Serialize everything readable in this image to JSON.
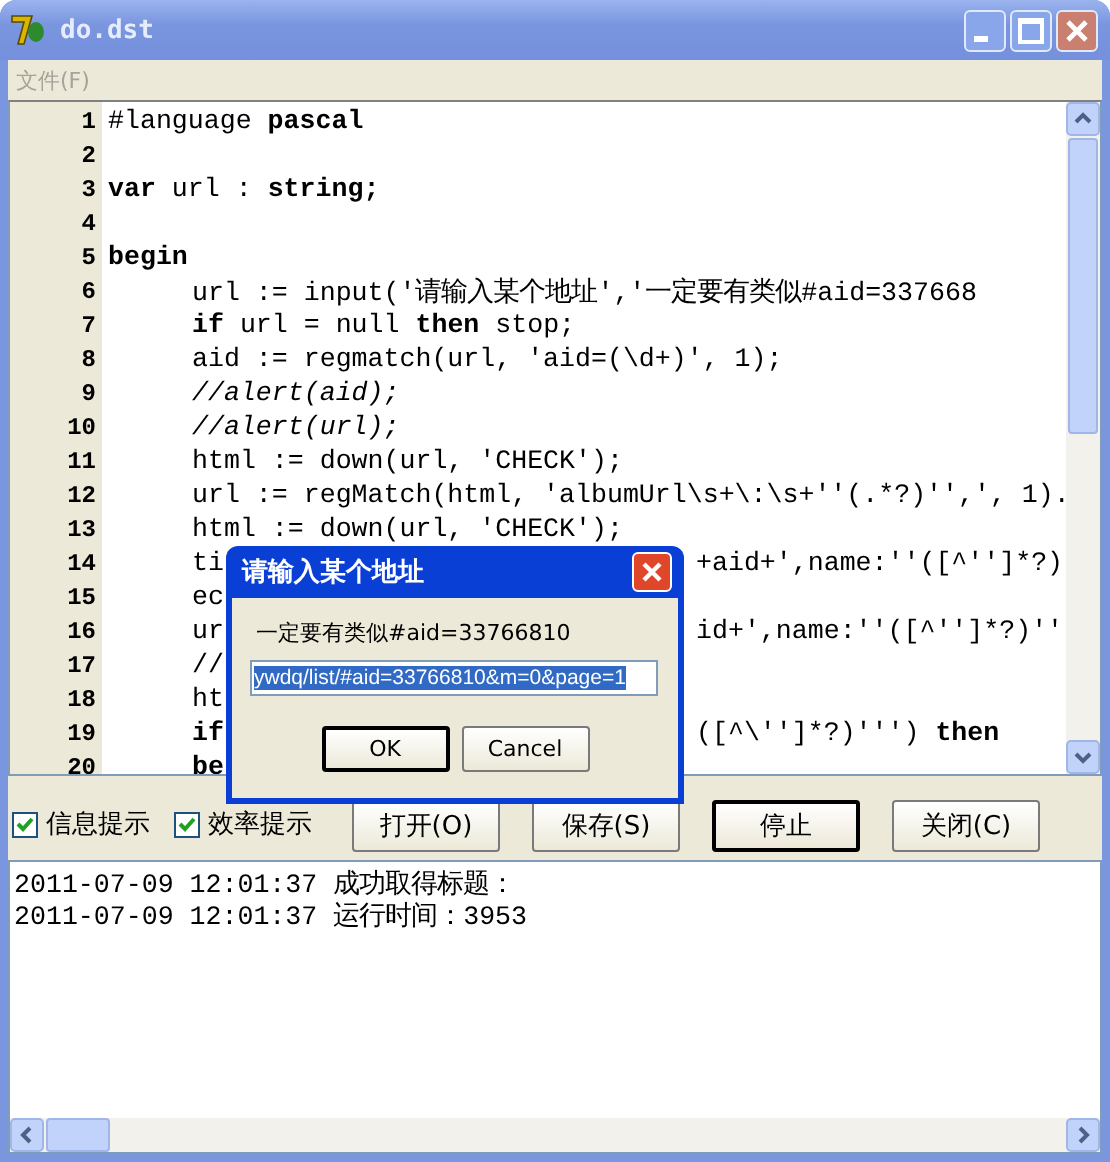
{
  "window": {
    "title": "do.dst"
  },
  "menu": [
    {
      "label": "文件(F)",
      "disabled": true
    }
  ],
  "editor": {
    "lines": [
      {
        "number": "1",
        "kind": "code",
        "text": "#language **pascal**"
      },
      {
        "number": "2",
        "kind": "blank"
      },
      {
        "number": "3",
        "kind": "code",
        "text": "**var** url : **string;**"
      },
      {
        "number": "4",
        "kind": "blank"
      },
      {
        "number": "5",
        "kind": "code",
        "text": "**begin**",
        "children": [
          {
            "number": "6",
            "kind": "code",
            "text": "url := input('请输入某个地址','一定要有类似#aid=337668"
          },
          {
            "number": "7",
            "kind": "code",
            "text": "**if** url = null **then** stop;"
          },
          {
            "number": "8",
            "kind": "code",
            "text": "aid := regmatch(url, 'aid=(\\d+)', 1);"
          },
          {
            "number": "9",
            "kind": "comment",
            "text": "//alert(aid);"
          },
          {
            "number": "10",
            "kind": "comment",
            "text": "//alert(url);"
          },
          {
            "number": "11",
            "kind": "code",
            "text": "html := down(url, 'CHECK');"
          },
          {
            "number": "12",
            "kind": "code",
            "text": "url := regMatch(html, 'albumUrl\\s+\\:\\s+''(.*?)'',', 1)."
          },
          {
            "number": "13",
            "kind": "code",
            "text": "html := down(url, 'CHECK');"
          },
          {
            "number": "14",
            "kind": "code",
            "text": "ti",
            "tail": "+aid+',name:''([^'']*?)"
          },
          {
            "number": "15",
            "kind": "code",
            "text": "ec"
          },
          {
            "number": "16",
            "kind": "code",
            "text": "ur",
            "tail": "id+',name:''([^'']*?)''"
          },
          {
            "number": "17",
            "kind": "code",
            "text": "//"
          },
          {
            "number": "18",
            "kind": "code",
            "text": "ht"
          },
          {
            "number": "19",
            "kind": "code",
            "text": "**if**",
            "tail": "([^\\'']*?)''') **then**"
          },
          {
            "number": "20",
            "kind": "code",
            "text": "**be**"
          }
        ]
      }
    ]
  },
  "options": [
    {
      "label": "信息提示",
      "checked": true
    },
    {
      "label": "效率提示",
      "checked": true
    }
  ],
  "buttons": [
    {
      "label": "打开(O)",
      "default": false
    },
    {
      "label": "保存(S)",
      "default": false
    },
    {
      "label": "停止",
      "default": true
    },
    {
      "label": "关闭(C)",
      "default": false
    }
  ],
  "log": [
    "2011-07-09 12:01:37 成功取得标题：",
    "2011-07-09 12:01:37 运行时间：3953"
  ],
  "dialog": {
    "title": "请输入某个地址",
    "prompt": "一定要有类似#aid=33766810",
    "value": "ywdq/list/#aid=33766810&m=0&page=1",
    "value_selected": true,
    "buttons": [
      {
        "label": "OK",
        "default": true
      },
      {
        "label": "Cancel",
        "default": false
      }
    ]
  }
}
